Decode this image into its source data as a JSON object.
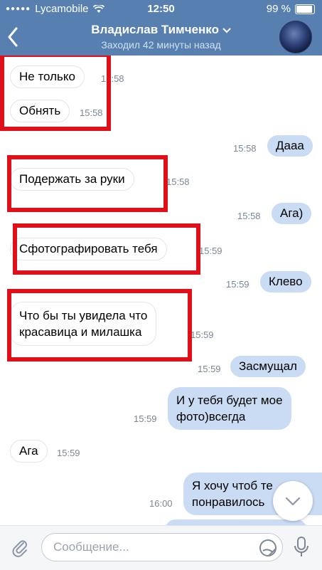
{
  "status_bar": {
    "carrier": "Lycamobile",
    "time": "12:50",
    "battery": "99 %"
  },
  "header": {
    "back_icon": "chevron-left-icon",
    "title": "Владислав Тимченко",
    "subtitle": "Заходил 42 минуты назад",
    "dropdown_icon": "chevron-down-icon"
  },
  "messages": [
    {
      "direction": "in",
      "text": "Не только",
      "time": "15:58"
    },
    {
      "direction": "in",
      "text": "Обнять",
      "time": "15:58"
    },
    {
      "direction": "out",
      "text": "Дааа",
      "time": "15:58"
    },
    {
      "direction": "in",
      "text": "Подержать за руки",
      "time": "15:58"
    },
    {
      "direction": "out",
      "text": "Ага)",
      "time": "15:58"
    },
    {
      "direction": "in",
      "text": "Сфотографировать тебя",
      "time": "15:59"
    },
    {
      "direction": "out",
      "text": "Клево",
      "time": "15:59"
    },
    {
      "direction": "in",
      "text": "Что бы ты увидела что\nкрасавица и милашка",
      "line1": "Что бы ты увидела что",
      "line2": "красавица и милашка",
      "time": "15:59"
    },
    {
      "direction": "out",
      "text": "Засмущал",
      "time": "15:59"
    },
    {
      "direction": "out",
      "text": "И у тебя будет мое\nфото)всегда",
      "line1": "И у тебя будет мое",
      "line2": "фото)всегда",
      "time": "15:59"
    },
    {
      "direction": "in",
      "text": "Ага",
      "time": "15:59"
    },
    {
      "direction": "out",
      "text": "Я хочу чтоб тебе\nпонравилось",
      "line1": "Я хочу чтоб те",
      "line2": "понравилось",
      "time": "16:00"
    }
  ],
  "composer": {
    "placeholder": "Сообщение..."
  },
  "colors": {
    "header": "#5780b0",
    "outgoing_bubble": "#c9dcf4",
    "highlight": "#e0101b"
  }
}
